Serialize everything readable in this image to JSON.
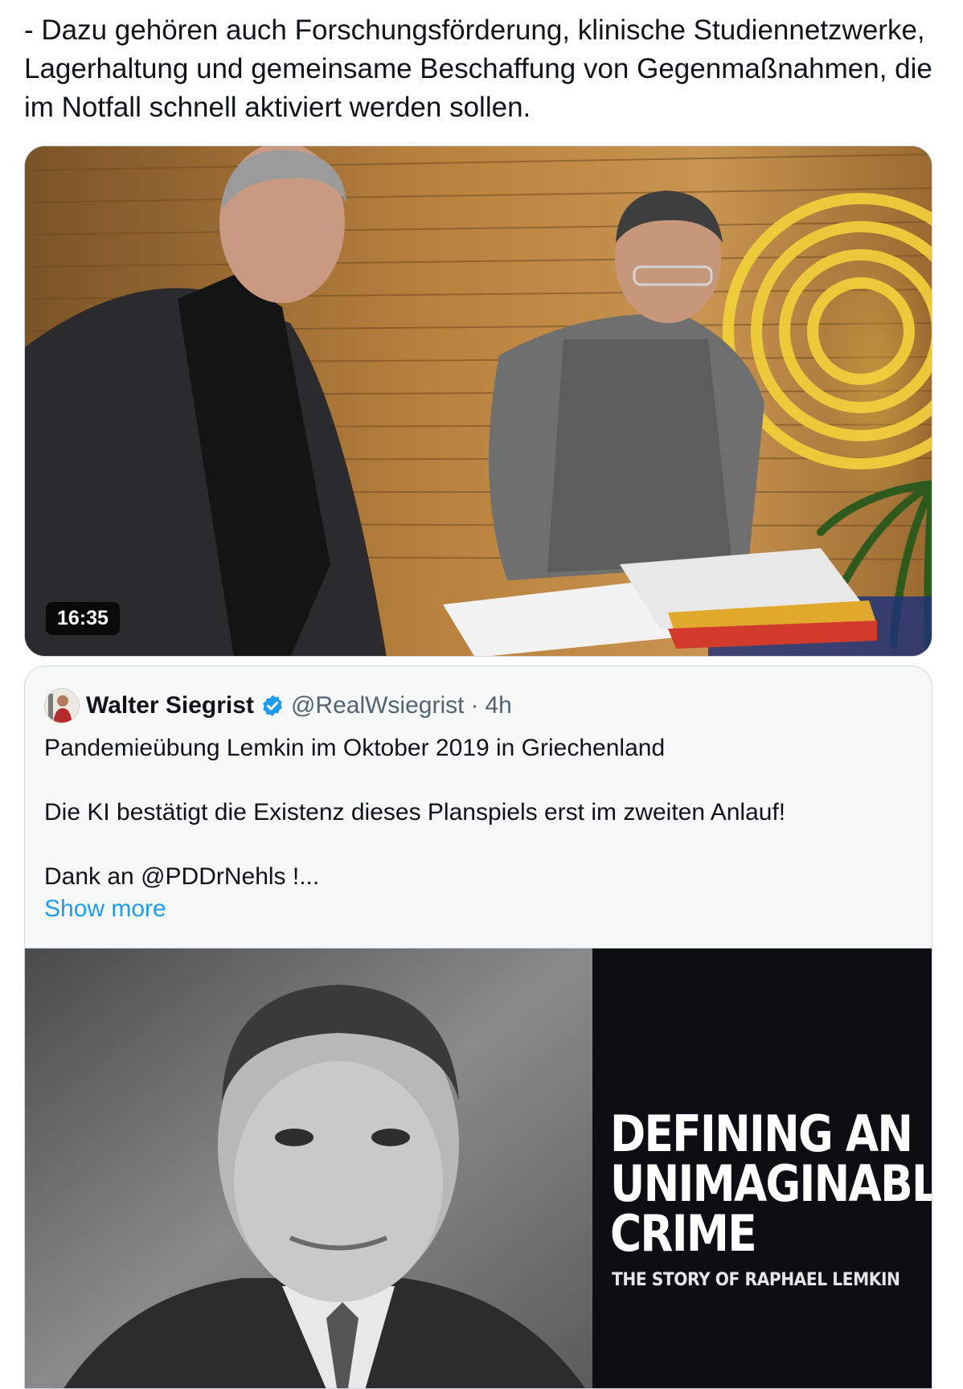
{
  "tweet": {
    "text": "- Dazu gehören auch Forschungsförderung, klinische Studiennetzwerke,\nLagerhaltung und gemeinsame Beschaffung von Gegenmaßnahmen, die\nim Notfall schnell aktiviert werden sollen."
  },
  "video": {
    "duration": "16:35"
  },
  "quote": {
    "name": "Walter Siegrist",
    "handle": "@RealWsiegrist",
    "separator": "·",
    "time": "4h",
    "paragraphs": [
      "Pandemieübung Lemkin im Oktober 2019 in Griechenland",
      "Die KI bestätigt die Existenz dieses Planspiels erst im zweiten Anlauf!",
      "Dank an @PDDrNehls !..."
    ],
    "show_more": "Show more",
    "media": {
      "title_lines": [
        "DEFINING AN",
        "UNIMAGINABLE",
        "CRIME"
      ],
      "subtitle": "THE STORY OF RAPHAEL LEMKIN"
    }
  },
  "icons": {
    "verified": "verified-badge-icon"
  },
  "colors": {
    "link": "#1d9bf0",
    "muted": "#536471",
    "text": "#0f1419",
    "verified": "#1d9bf0"
  }
}
